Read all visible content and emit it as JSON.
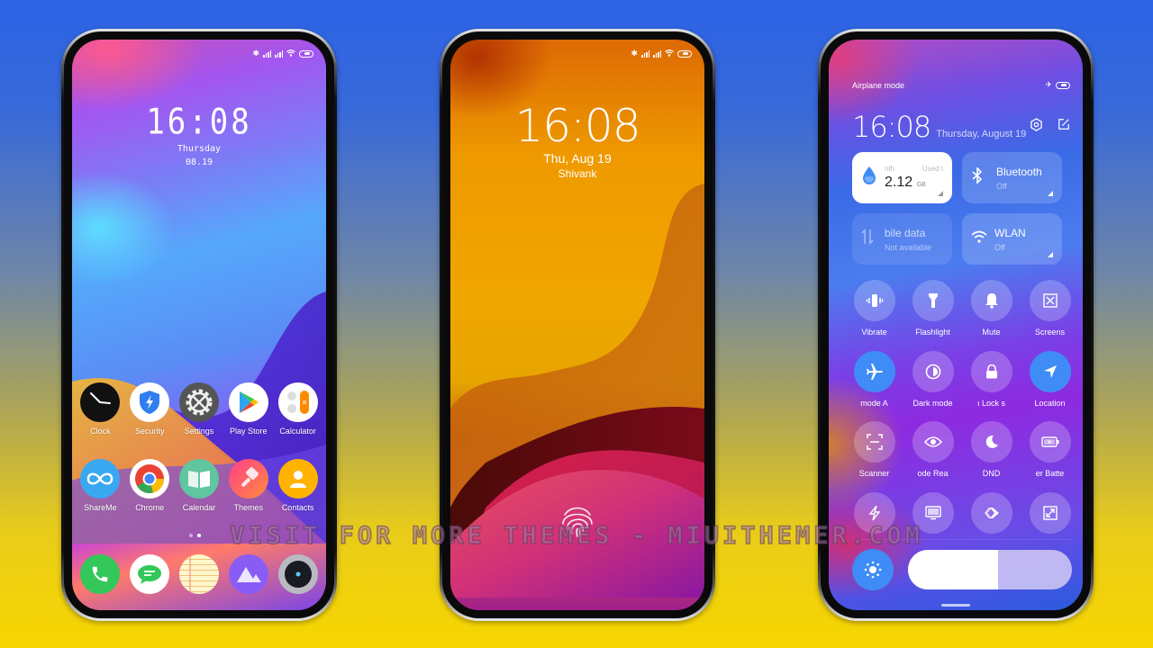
{
  "phones": {
    "home": {
      "status_icons": [
        "bluetooth-icon",
        "signal-icon",
        "signal-icon",
        "wifi-icon",
        "battery-icon"
      ],
      "clock": {
        "time": "16:08",
        "day": "Thursday",
        "date": "08.19"
      },
      "apps_row1": [
        {
          "label": "Clock",
          "icon": "clock-icon"
        },
        {
          "label": "Security",
          "icon": "shield-bolt-icon"
        },
        {
          "label": "Settings",
          "icon": "gear-icon"
        },
        {
          "label": "Play Store",
          "icon": "play-store-icon"
        },
        {
          "label": "Calculator",
          "icon": "calculator-icon"
        }
      ],
      "apps_row2": [
        {
          "label": "ShareMe",
          "icon": "infinity-icon"
        },
        {
          "label": "Chrome",
          "icon": "chrome-icon"
        },
        {
          "label": "Calendar",
          "icon": "calendar-book-icon"
        },
        {
          "label": "Themes",
          "icon": "paint-brush-icon"
        },
        {
          "label": "Contacts",
          "icon": "person-icon"
        }
      ],
      "dock": [
        {
          "icon": "phone-icon"
        },
        {
          "icon": "messages-icon"
        },
        {
          "icon": "notes-icon"
        },
        {
          "icon": "gallery-icon"
        },
        {
          "icon": "camera-icon"
        }
      ],
      "page_count": 2,
      "current_page": 2
    },
    "lock": {
      "time": "16:08",
      "date": "Thu, Aug 19",
      "owner": "Shivank"
    },
    "control_center": {
      "header_label": "Airplane mode",
      "time": "16:08",
      "date": "Thursday, August 19",
      "data_tile": {
        "left_label": "nth",
        "right_label": "Used t",
        "value": "2.12",
        "unit": "GB"
      },
      "bluetooth_tile": {
        "title": "Bluetooth",
        "status": "Off"
      },
      "mobile_data_tile": {
        "title": "bile data",
        "status": "Not available"
      },
      "wlan_tile": {
        "title": "WLAN",
        "status": "Off"
      },
      "toggles": [
        {
          "label": "Vibrate",
          "icon": "vibrate-icon",
          "active": false
        },
        {
          "label": "Flashlight",
          "icon": "flashlight-icon",
          "active": false
        },
        {
          "label": "Mute",
          "icon": "bell-icon",
          "active": false
        },
        {
          "label": "Screens",
          "icon": "screenshot-icon",
          "active": false
        },
        {
          "label": "mode    A",
          "icon": "airplane-icon",
          "active": true
        },
        {
          "label": "Dark mode",
          "icon": "dark-mode-icon",
          "active": false
        },
        {
          "label": "ı   Lock s",
          "icon": "lock-icon",
          "active": false
        },
        {
          "label": "Location",
          "icon": "location-icon",
          "active": true
        },
        {
          "label": "Scanner",
          "icon": "scanner-icon",
          "active": false
        },
        {
          "label": "ode   Rea",
          "icon": "eye-icon",
          "active": false
        },
        {
          "label": "DND",
          "icon": "moon-icon",
          "active": false
        },
        {
          "label": "er   Batte",
          "icon": "battery-saver-icon",
          "active": false
        },
        {
          "label": "",
          "icon": "bolt-icon",
          "active": false
        },
        {
          "label": "",
          "icon": "cast-screen-icon",
          "active": false
        },
        {
          "label": "",
          "icon": "mi-share-icon",
          "active": false
        },
        {
          "label": "",
          "icon": "resize-icon",
          "active": false
        }
      ],
      "brightness_percent": 55
    }
  },
  "watermark": "VISIT FOR MORE THEMES - MIUITHEMER.COM"
}
